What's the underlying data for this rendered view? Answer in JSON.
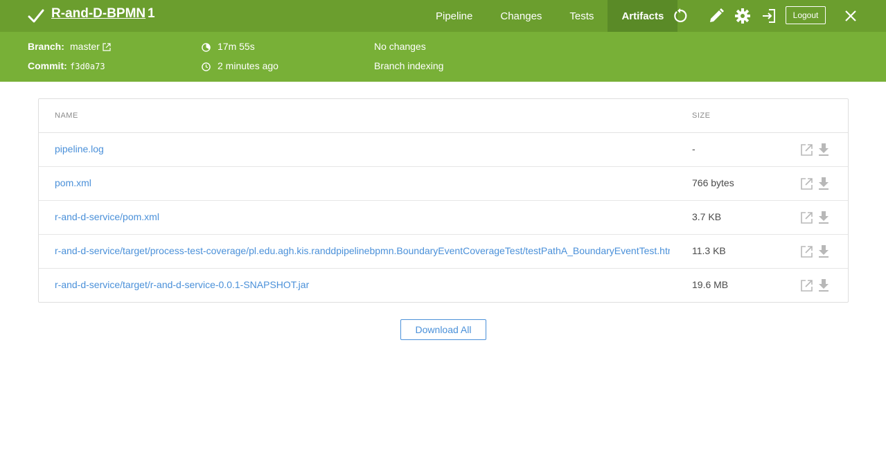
{
  "header": {
    "status_icon": "check-icon",
    "title": "R-and-D-BPMN",
    "run_number": "1",
    "tabs": [
      {
        "label": "Pipeline",
        "active": false
      },
      {
        "label": "Changes",
        "active": false
      },
      {
        "label": "Tests",
        "active": false
      },
      {
        "label": "Artifacts",
        "active": true
      }
    ],
    "icons": [
      "replay-icon",
      "edit-icon",
      "gear-icon",
      "exit-icon",
      "close-icon"
    ],
    "logout_label": "Logout",
    "color": "#6b9e2e",
    "active_tab_color": "#5a8a27"
  },
  "info": {
    "branch_label": "Branch:",
    "branch_value": "master",
    "commit_label": "Commit:",
    "commit_value": "f3d0a73",
    "duration": "17m 55s",
    "time_ago": "2 minutes ago",
    "changes": "No changes",
    "cause": "Branch indexing",
    "color": "#78b037"
  },
  "artifacts": {
    "columns": {
      "name": "NAME",
      "size": "SIZE"
    },
    "rows": [
      {
        "name": "pipeline.log",
        "size": "-"
      },
      {
        "name": "pom.xml",
        "size": "766 bytes"
      },
      {
        "name": "r-and-d-service/pom.xml",
        "size": "3.7 KB"
      },
      {
        "name": "r-and-d-service/target/process-test-coverage/pl.edu.agh.kis.randdpipelinebpmn.BoundaryEventCoverageTest/testPathA_BoundaryEventTest.html",
        "size": "11.3 KB"
      },
      {
        "name": "r-and-d-service/target/r-and-d-service-0.0.1-SNAPSHOT.jar",
        "size": "19.6 MB"
      }
    ],
    "link_color": "#4a90d9"
  },
  "download_all_label": "Download All"
}
